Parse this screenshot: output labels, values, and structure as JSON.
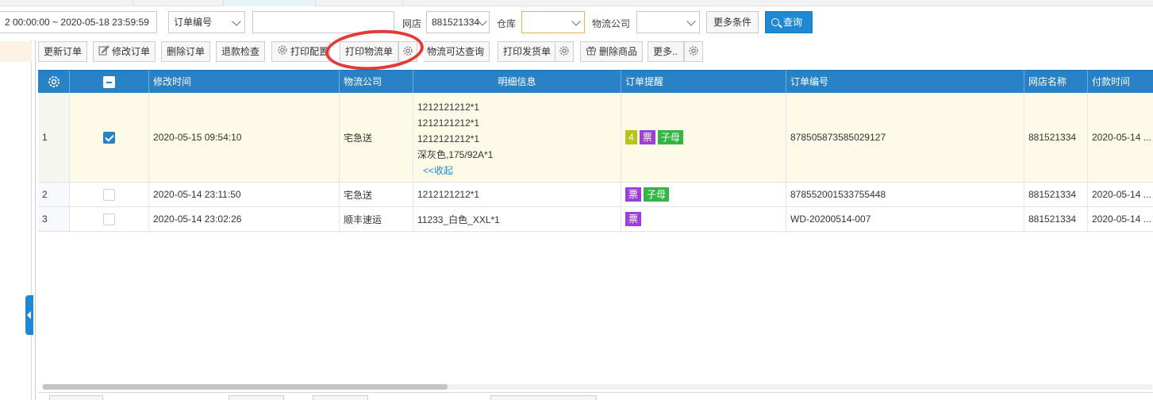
{
  "filters": {
    "date_range": "2 00:00:00 ~ 2020-05-18 23:59:59",
    "order_field_select": "订单编号",
    "order_value": "",
    "shop_label": "网店",
    "shop_value": "881521334",
    "warehouse_label": "仓库",
    "warehouse_value": "",
    "logistics_label": "物流公司",
    "logistics_value": "",
    "more_conditions": "更多条件",
    "query_button": "查询"
  },
  "toolbar": {
    "update_order": "更新订单",
    "edit_order": "修改订单",
    "delete_order": "删除订单",
    "refund_check": "退款检查",
    "print_config": "打印配置",
    "print_waybill": "打印物流单",
    "logistics_reach": "物流可达查询",
    "print_delivery": "打印发货单",
    "delete_goods": "删除商品",
    "more": "更多.."
  },
  "table": {
    "headers": {
      "modified_time": "修改时间",
      "logistics": "物流公司",
      "detail": "明细信息",
      "remind": "订单提醒",
      "order_no": "订单编号",
      "shop_name": "网店名称",
      "pay_time": "付款时间"
    },
    "rows": [
      {
        "index": "1",
        "checked": true,
        "modified_time": "2020-05-15 09:54:10",
        "logistics": "宅急送",
        "detail_lines": [
          "1212121212*1",
          "1212121212*1",
          "1212121212*1",
          "深灰色,175/92A*1"
        ],
        "collapse_link": "<<收起",
        "tags": [
          "4",
          "票",
          "子母"
        ],
        "order_no": "878505873585029127",
        "shop_name": "881521334",
        "pay_time": "2020-05-14 ..."
      },
      {
        "index": "2",
        "checked": false,
        "modified_time": "2020-05-14 23:11:50",
        "logistics": "宅急送",
        "detail_lines": [
          "1212121212*1"
        ],
        "tags": [
          "票",
          "子母"
        ],
        "order_no": "878552001533755448",
        "shop_name": "881521334",
        "pay_time": "2020-05-14 ..."
      },
      {
        "index": "3",
        "checked": false,
        "modified_time": "2020-05-14 23:02:26",
        "logistics": "顺丰速运",
        "detail_lines": [
          "11233_白色_XXL*1"
        ],
        "tags": [
          "票"
        ],
        "order_no": "WD-20200514-007",
        "shop_name": "881521334",
        "pay_time": "2020-05-14 ..."
      }
    ]
  },
  "colors": {
    "header_blue": "#2a82c6",
    "primary_blue": "#1e88d4",
    "selected_row": "#fdfbe7",
    "annotation_red": "#e53935",
    "tag_purple": "#9b3fd6",
    "tag_green": "#33b645",
    "tag_olive": "#b6c414"
  }
}
